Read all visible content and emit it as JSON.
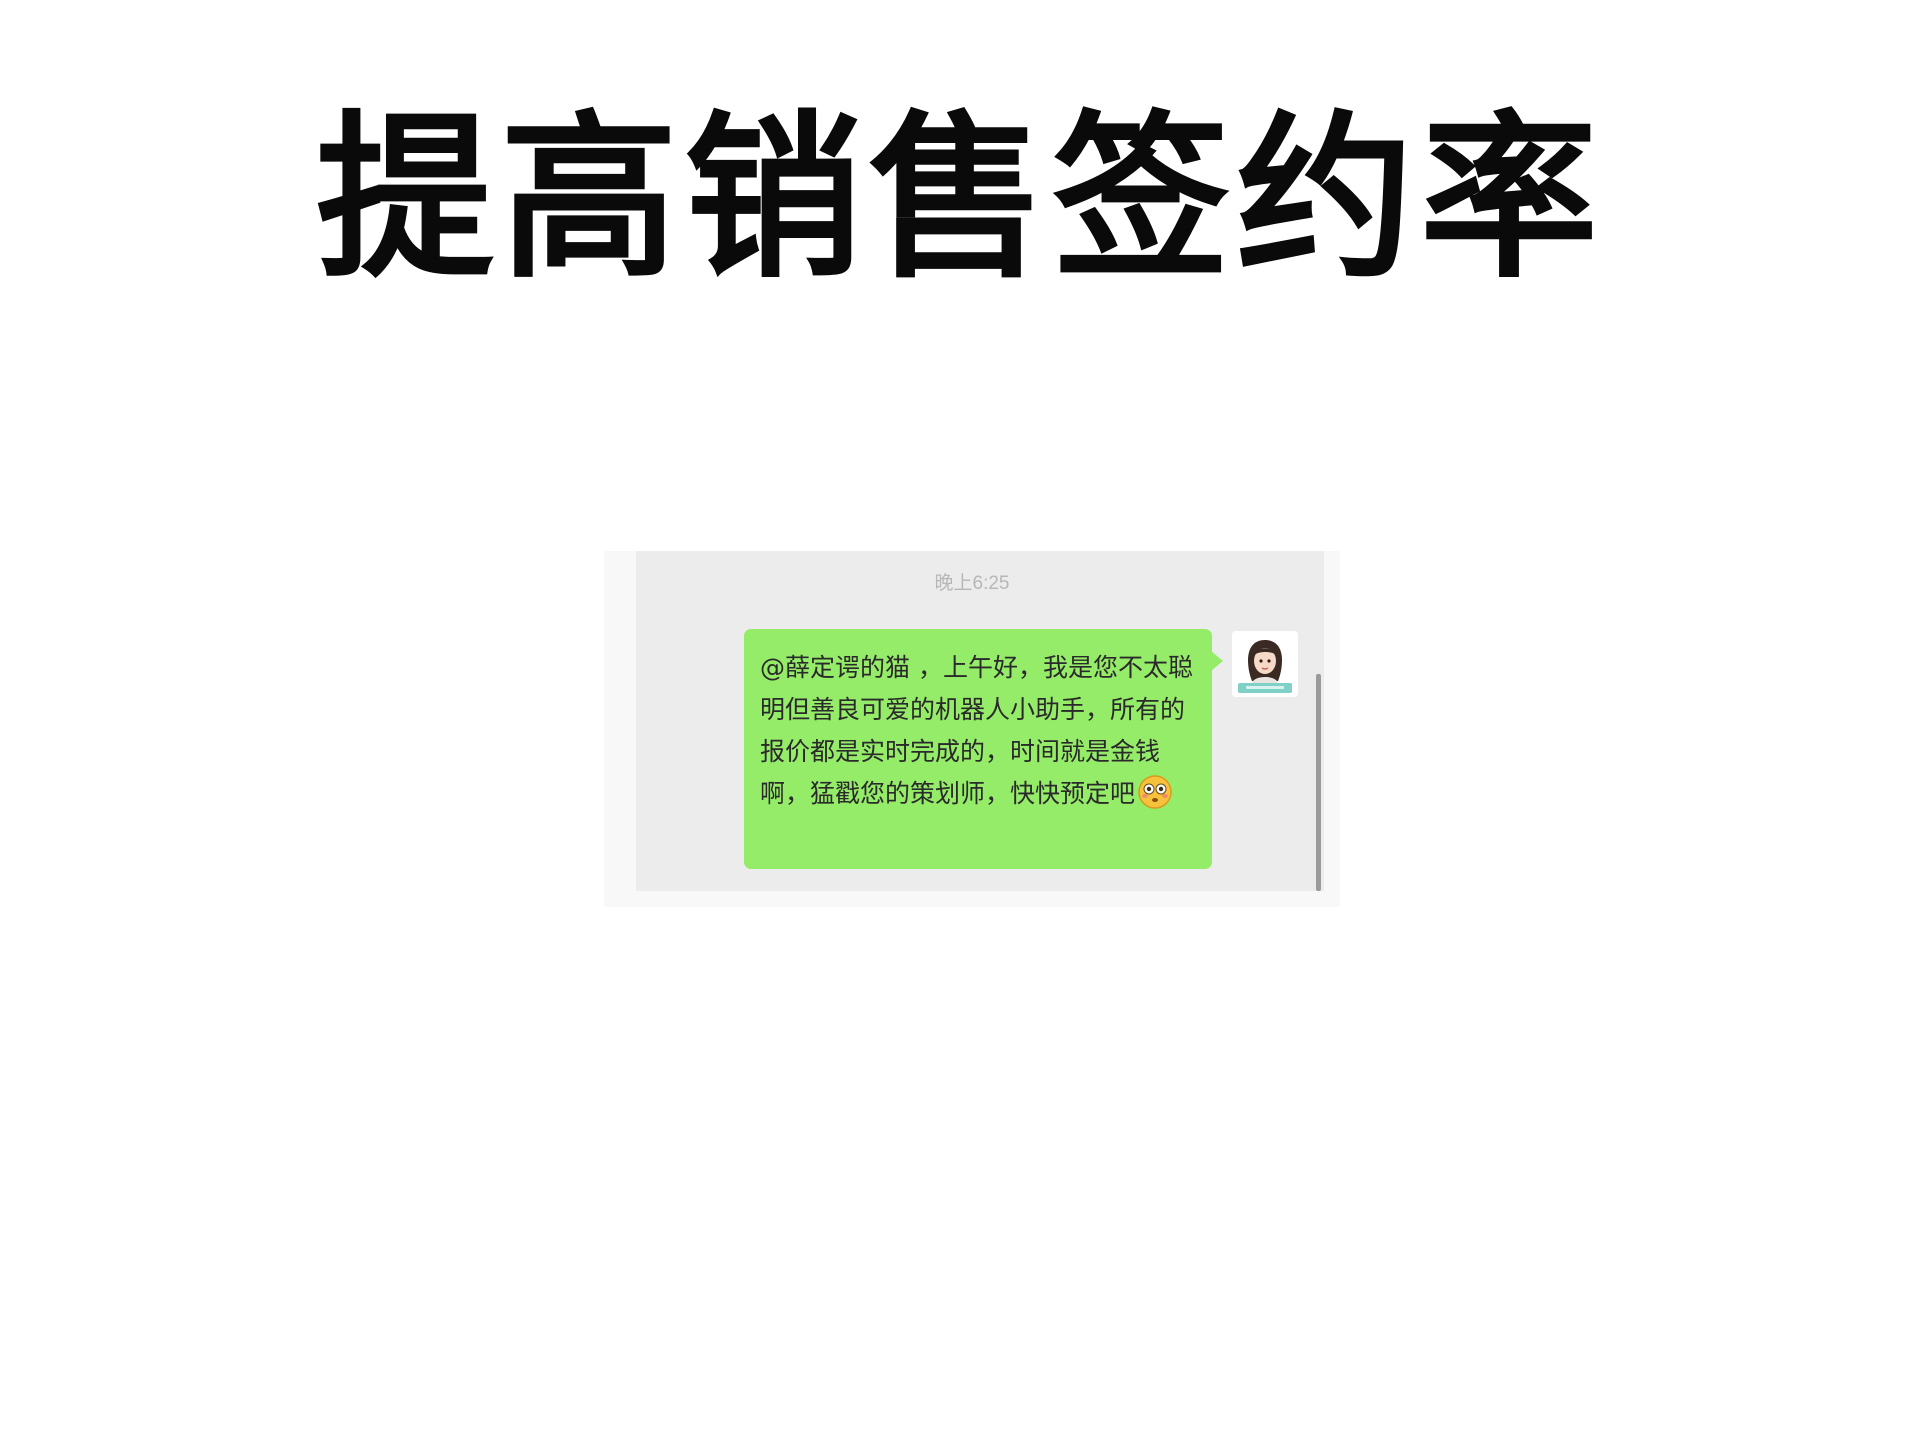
{
  "page": {
    "title": "提高销售签约率"
  },
  "chat": {
    "timestamp": "晚上6:25",
    "message": {
      "text": "@薛定谔的猫 ，上午好，我是您不太聪明但善良可爱的机器人小助手，所有的报价都是实时完成的，时间就是金钱啊，猛戳您的策划师，快快预定吧",
      "emoji": "flushed-face-icon"
    },
    "avatar": {
      "icon": "avatar-girl-icon"
    }
  },
  "colors": {
    "bubble": "#95ec69",
    "chat_background": "#ececec",
    "timestamp": "#b7b7b7",
    "title": "#0a0a0a"
  }
}
